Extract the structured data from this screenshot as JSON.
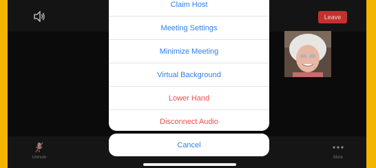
{
  "top_bar": {
    "leave_label": "Leave"
  },
  "action_sheet": {
    "items": [
      {
        "label": "Claim Host",
        "color": "#2f7ef0"
      },
      {
        "label": "Meeting Settings",
        "color": "#2f7ef0"
      },
      {
        "label": "Minimize Meeting",
        "color": "#2f7ef0"
      },
      {
        "label": "Virtual Background",
        "color": "#2f7ef0"
      },
      {
        "label": "Lower Hand",
        "color": "#ef4a4a"
      },
      {
        "label": "Disconnect Audio",
        "color": "#ef4a4a"
      }
    ],
    "cancel_label": "Cancel"
  },
  "toolbar": {
    "items": [
      {
        "label": "Unmute",
        "icon": "microphone-muted-icon"
      },
      {
        "label": "More",
        "icon": "more-dots-icon"
      }
    ]
  },
  "colors": {
    "frame": "#f5b400",
    "leave": "#c62f2f",
    "action": "#2f7ef0",
    "destructive": "#ef4a4a"
  }
}
